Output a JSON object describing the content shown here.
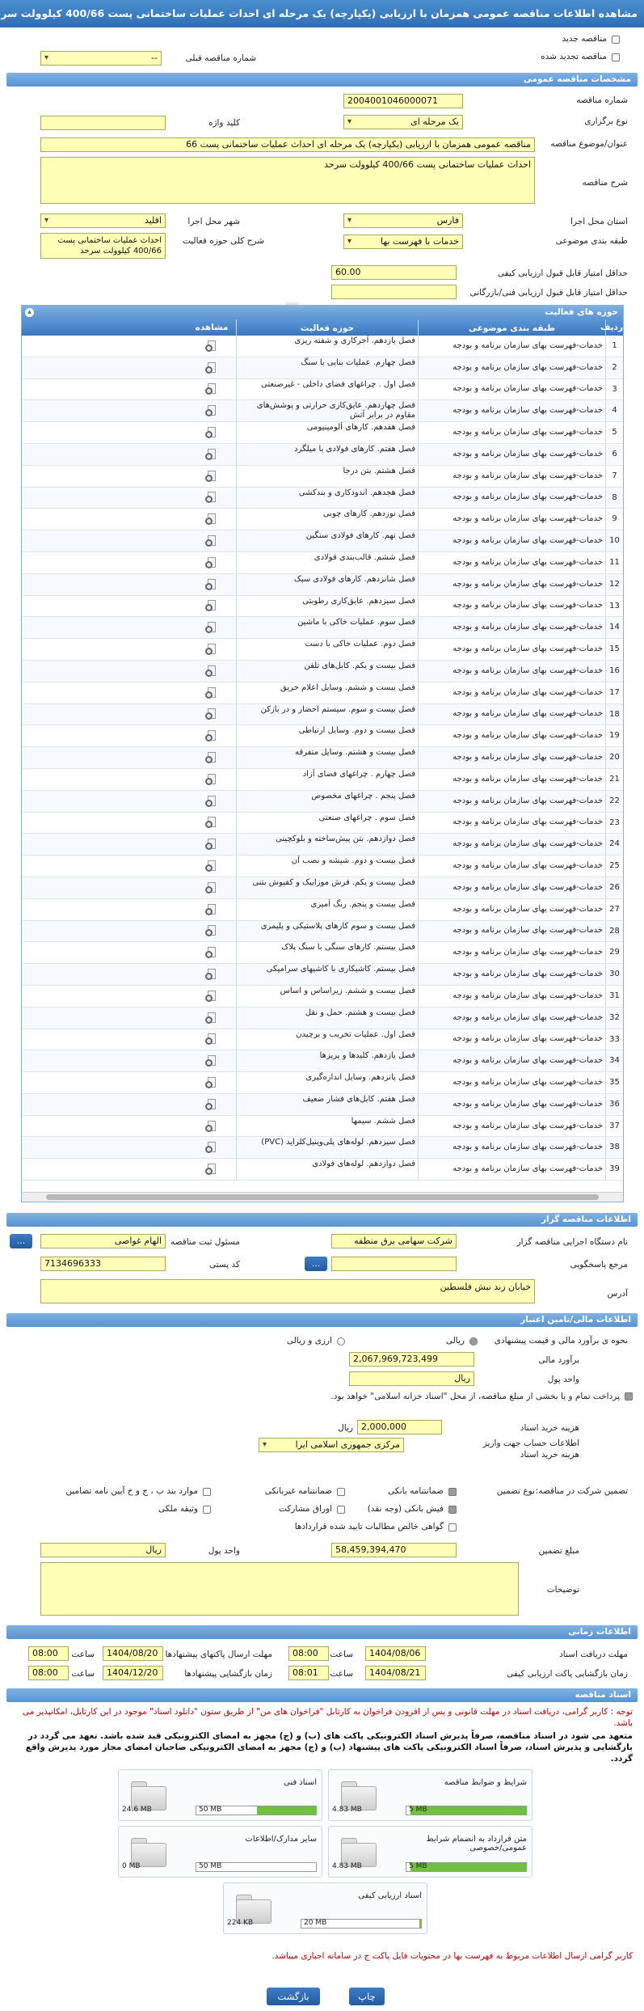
{
  "title": "مشاهده اطلاعات مناقصه عمومی همزمان با ارزیابی (یکپارچه) یک مرحله ای احداث عملیات ساختمانی پست 400/66 کیلوولت سرحد",
  "top": {
    "new_label": "مناقصه جدید",
    "renew_label": "مناقصه تجدید شده",
    "prev_number_label": "شماره مناقصه قبلی",
    "prev_number_value": "--"
  },
  "general": {
    "header": "مشخصات مناقصه عمومی",
    "number_label": "شماره مناقصه",
    "number": "2004001046000071",
    "type_label": "نوع برگزاری",
    "type": "یک مرحله ای",
    "keyword_label": "کلید واژه",
    "keyword": "",
    "subject_label": "عنوان/موضوع مناقصه",
    "subject": "مناقصه عمومی همزمان با ارزیابی (یکپارچه) یک مرحله ای احداث عملیات ساختمانی پست 66",
    "desc_label": "شرح مناقصه",
    "desc": "احداث عملیات ساختمانی پست 400/66 کیلوولت سرحد",
    "province_label": "استان محل اجرا",
    "province": "فارس",
    "city_label": "شهر محل اجرا",
    "city": "اقلید",
    "category_label": "طبقه بندی موضوعی",
    "category": "خدمات با فهرست بها",
    "activity_label": "شرح کلی حوزه فعالیت",
    "activity": "احداث عملیات ساختمانی پست 400/66 کیلوولت سرحد",
    "min_quality_label": "حداقل امتیاز قابل قبول ارزیابی کیفی",
    "min_quality": "60.00",
    "min_tech_label": "حداقل امتیاز قابل قبول ارزیابی فنی/بازرگانی",
    "min_tech": ""
  },
  "activities": {
    "header": "حوزه های فعالیت",
    "columns": [
      "ردیف",
      "طبقه بندی موضوعی",
      "حوزه فعالیت",
      "مشاهده"
    ],
    "rows": [
      {
        "n": "1",
        "cat": "خدمات-فهرست بهای سازمان برنامه و بودجه",
        "act": "فصل یازدهم. آجرکاری و شفته ریزی"
      },
      {
        "n": "2",
        "cat": "خدمات-فهرست بهای سازمان برنامه و بودجه",
        "act": "فصل چهارم. عملیات بنایی با سنگ"
      },
      {
        "n": "3",
        "cat": "خدمات-فهرست بهای سازمان برنامه و بودجه",
        "act": "فصل اول . چراغهای فضای داخلی - غیرصنعتی"
      },
      {
        "n": "4",
        "cat": "خدمات-فهرست بهای سازمان برنامه و بودجه",
        "act": "فصل چهاردهم. عایق‌کاری حرارتی و پوشش‌های مقاوم در برابر آتش"
      },
      {
        "n": "5",
        "cat": "خدمات-فهرست بهای سازمان برنامه و بودجه",
        "act": "فصل هفدهم. کارهای آلومینیومی"
      },
      {
        "n": "6",
        "cat": "خدمات-فهرست بهای سازمان برنامه و بودجه",
        "act": "فصل هفتم. کارهای فولادی با میلگرد"
      },
      {
        "n": "7",
        "cat": "خدمات-فهرست بهای سازمان برنامه و بودجه",
        "act": "فصل هشتم. بتن درجا"
      },
      {
        "n": "8",
        "cat": "خدمات-فهرست بهای سازمان برنامه و بودجه",
        "act": "فصل هجدهم. اندودکاری و بندکشی"
      },
      {
        "n": "9",
        "cat": "خدمات-فهرست بهای سازمان برنامه و بودجه",
        "act": "فصل نوزدهم. کارهای چوبی"
      },
      {
        "n": "10",
        "cat": "خدمات-فهرست بهای سازمان برنامه و بودجه",
        "act": "فصل نهم. کارهای فولادی سنگین"
      },
      {
        "n": "11",
        "cat": "خدمات-فهرست بهای سازمان برنامه و بودجه",
        "act": "فصل ششم. قالب‌بندی فولادی"
      },
      {
        "n": "12",
        "cat": "خدمات-فهرست بهای سازمان برنامه و بودجه",
        "act": "فصل شانزدهم. کارهای فولادی سبک"
      },
      {
        "n": "13",
        "cat": "خدمات-فهرست بهای سازمان برنامه و بودجه",
        "act": "فصل سیزدهم. عایق‌کاری رطوبتی"
      },
      {
        "n": "14",
        "cat": "خدمات-فهرست بهای سازمان برنامه و بودجه",
        "act": "فصل سوم. عملیات خاکی با ماشین"
      },
      {
        "n": "15",
        "cat": "خدمات-فهرست بهای سازمان برنامه و بودجه",
        "act": "فصل دوم. عملیات خاکی با دست"
      },
      {
        "n": "16",
        "cat": "خدمات-فهرست بهای سازمان برنامه و بودجه",
        "act": "فصل بیست و یکم. کابل‌های تلفن"
      },
      {
        "n": "17",
        "cat": "خدمات-فهرست بهای سازمان برنامه و بودجه",
        "act": "فصل بیست و ششم. وسایل اعلام حریق"
      },
      {
        "n": "18",
        "cat": "خدمات-فهرست بهای سازمان برنامه و بودجه",
        "act": "فصل بیست و سوم. سیستم احضار و در بازکن"
      },
      {
        "n": "19",
        "cat": "خدمات-فهرست بهای سازمان برنامه و بودجه",
        "act": "فصل بیست و دوم. وسایل ارتباطی"
      },
      {
        "n": "20",
        "cat": "خدمات-فهرست بهای سازمان برنامه و بودجه",
        "act": "فصل بیست و هشتم. وسایل متفرقه"
      },
      {
        "n": "21",
        "cat": "خدمات-فهرست بهای سازمان برنامه و بودجه",
        "act": "فصل چهارم . چراغهای فضای آزاد"
      },
      {
        "n": "22",
        "cat": "خدمات-فهرست بهای سازمان برنامه و بودجه",
        "act": "فصل پنجم . چراغهای مخصوص"
      },
      {
        "n": "23",
        "cat": "خدمات-فهرست بهای سازمان برنامه و بودجه",
        "act": "فصل سوم . چراغهای صنعتی"
      },
      {
        "n": "24",
        "cat": "خدمات-فهرست بهای سازمان برنامه و بودجه",
        "act": "فصل دوازدهم. بتن پیش‌ساخته و بلوکچینی"
      },
      {
        "n": "25",
        "cat": "خدمات-فهرست بهای سازمان برنامه و بودجه",
        "act": "فصل بیست و دوم. شیشه و نصب آن"
      },
      {
        "n": "26",
        "cat": "خدمات-فهرست بهای سازمان برنامه و بودجه",
        "act": "فصل بیست و یکم. فرش موزاییک و کفپوش بتنی"
      },
      {
        "n": "27",
        "cat": "خدمات-فهرست بهای سازمان برنامه و بودجه",
        "act": "فصل بیست و پنجم. رنگ آمیزی"
      },
      {
        "n": "28",
        "cat": "خدمات-فهرست بهای سازمان برنامه و بودجه",
        "act": "فصل بیست و سوم کارهای پلاستیکی و پلیمری"
      },
      {
        "n": "29",
        "cat": "خدمات-فهرست بهای سازمان برنامه و بودجه",
        "act": "فصل بیستم. کارهای سنگی با سنگ پلاک"
      },
      {
        "n": "30",
        "cat": "خدمات-فهرست بهای سازمان برنامه و بودجه",
        "act": "فصل بیستم. کاشیکاری با کاشیهای سرامیکی"
      },
      {
        "n": "31",
        "cat": "خدمات-فهرست بهای سازمان برنامه و بودجه",
        "act": "فصل بیست و ششم. زیراساس و اساس"
      },
      {
        "n": "32",
        "cat": "خدمات-فهرست بهای سازمان برنامه و بودجه",
        "act": "فصل بیست و هشتم. حمل و نقل"
      },
      {
        "n": "33",
        "cat": "خدمات-فهرست بهای سازمان برنامه و بودجه",
        "act": "فصل اول. عملیات تخریب و برچیدن"
      },
      {
        "n": "34",
        "cat": "خدمات-فهرست بهای سازمان برنامه و بودجه",
        "act": "فصل یازدهم. کلیدها و پریزها"
      },
      {
        "n": "35",
        "cat": "خدمات-فهرست بهای سازمان برنامه و بودجه",
        "act": "فصل پانزدهم. وسایل اندازه‌گیری"
      },
      {
        "n": "36",
        "cat": "خدمات-فهرست بهای سازمان برنامه و بودجه",
        "act": "فصل هفتم. کابل‌های فشار ضعیف"
      },
      {
        "n": "37",
        "cat": "خدمات-فهرست بهای سازمان برنامه و بودجه",
        "act": "فصل ششم. سیمها"
      },
      {
        "n": "38",
        "cat": "خدمات-فهرست بهای سازمان برنامه و بودجه",
        "act": "فصل سیزدهم. لوله‌های پلی‌وینیل‌کلراید (PVC)"
      },
      {
        "n": "39",
        "cat": "خدمات-فهرست بهای سازمان برنامه و بودجه",
        "act": "فصل دوازدهم. لوله‌های فولادی"
      }
    ]
  },
  "organizer": {
    "header": "اطلاعات مناقصه گزار",
    "org_label": "نام دستگاه اجرایی مناقصه گزار",
    "org": "شرکت سهامی برق منطقه",
    "officer_label": "مسئول ثبت مناقصه",
    "officer": "الهام غواصی",
    "ref_label": "مرجع پاسخگویی",
    "ref": "",
    "postal_label": "کد پستی",
    "postal": "7134696333",
    "address_label": "آدرس",
    "address": "خیابان زند نبش فلسطین",
    "more_btn": "..."
  },
  "finance": {
    "header": "اطلاعات مالی/تامین اعتبار",
    "estimate_type_label": "نحوه ی برآورد مالی و قیمت پیشنهادی",
    "rial_label": "ریالی",
    "fx_label": "ارزی و ریالی",
    "estimate_label": "برآورد مالی",
    "estimate": "2,067,969,723,499",
    "currency_label": "واحد پول",
    "currency": "ریال",
    "payment_note": "پرداخت تمام و یا بخشی از مبلغ مناقصه، از محل \"اسناد خزانه اسلامی\" خواهد بود.",
    "doc_fee_label": "هزینه خرید اسناد",
    "doc_fee": "2,000,000",
    "doc_fee_unit": "ریال",
    "bank_label": "اطلاعات حساب جهت واریز هزینه خرید اسناد",
    "bank": "مرکزی جمهوری اسلامی ایرا"
  },
  "guarantee": {
    "label": "تضمین شرکت در مناقصه:",
    "type_label": "نوع تضمین",
    "options": [
      "ضمانتنامه بانکی",
      "ضمانتنامه غیربانکی",
      "موارد بند ب ، ج و خ آیین نامه تضامین",
      "فیش بانکی (وجه نقد)",
      "اوراق مشارکت",
      "وثیقه ملکی",
      "گواهی خالص مطالبات تایید شده قراردادها"
    ],
    "amount_label": "مبلغ تضمین",
    "amount": "58,459,394,470",
    "currency_label": "واحد پول",
    "currency": "ریال",
    "notes_label": "توضیحات",
    "notes": ""
  },
  "timing": {
    "header": "اطلاعات زمانی",
    "doc_deadline_label": "مهلت دریافت اسناد",
    "doc_deadline_date": "1404/08/06",
    "doc_deadline_time": "08:00",
    "send_deadline_label": "مهلت ارسال پاکتهای پیشنهادها",
    "send_deadline_date": "1404/08/20",
    "send_deadline_time": "08:00",
    "quality_open_label": "زمان بازگشایی پاکت ارزیابی کیفی",
    "quality_open_date": "1404/08/21",
    "quality_open_time": "08:01",
    "offer_open_label": "زمان بازگشایی پیشنهادها",
    "offer_open_date": "1404/12/20",
    "offer_open_time": "08:00",
    "time_label": "ساعت"
  },
  "documents": {
    "header": "اسناد مناقصه",
    "note_red": "توجه : کاربر گرامی، دریافت اسناد در مهلت قانونی و پس از افزودن فراخوان به کارتابل \"فراخوان های من\" از طریق ستون \"دانلود اسناد\" موجود در این کارتابل، امکانپذیر می باشد.",
    "note_black": "متعهد می شود در اسناد مناقصه، صرفاً پذیرش اسناد الکترونیکی پاکت های (ب) و (ج) مجهز به امضای الکترونیکی قید شده باشد. تعهد می گردد در بازگشایی و پذیرش اسناد، صرفاً اسناد الکترونیکی پاکت های پیشنهاد (ب) و (ج) مجهز به امضای الکترونیکی صاحبان امضای مجاز مورد پذیرش واقع گردد.",
    "files": [
      {
        "name": "شرایط و ضوابط مناقصه",
        "size": "4.83 MB",
        "max": "5 MB",
        "pct": 0.966
      },
      {
        "name": "اسناد فنی",
        "size": "24.6 MB",
        "max": "50 MB",
        "pct": 0.492
      },
      {
        "name": "متن قرارداد به انضمام شرایط عمومی/خصوصی",
        "size": "4.83 MB",
        "max": "5 MB",
        "pct": 0.966
      },
      {
        "name": "سایر مدارک/اطلاعات",
        "size": "0 MB",
        "max": "50 MB",
        "pct": 0
      },
      {
        "name": "اسناد ارزیابی کیفی",
        "size": "224 KB",
        "max": "20 MB",
        "pct": 0.011
      }
    ],
    "bottom_note": "کاربر گرامی ارسال اطلاعات مربوط به فهرست بها در محتویات فایل پاکت ج در سامانه اجباری میباشد."
  },
  "buttons": {
    "back": "بازگشت",
    "print": "چاپ"
  },
  "watermark": "TanderNet",
  "colors": {
    "accent": "#3a7ac4",
    "field": "#ffffb8",
    "alert": "#c00000",
    "progress": "#6ec03f"
  }
}
